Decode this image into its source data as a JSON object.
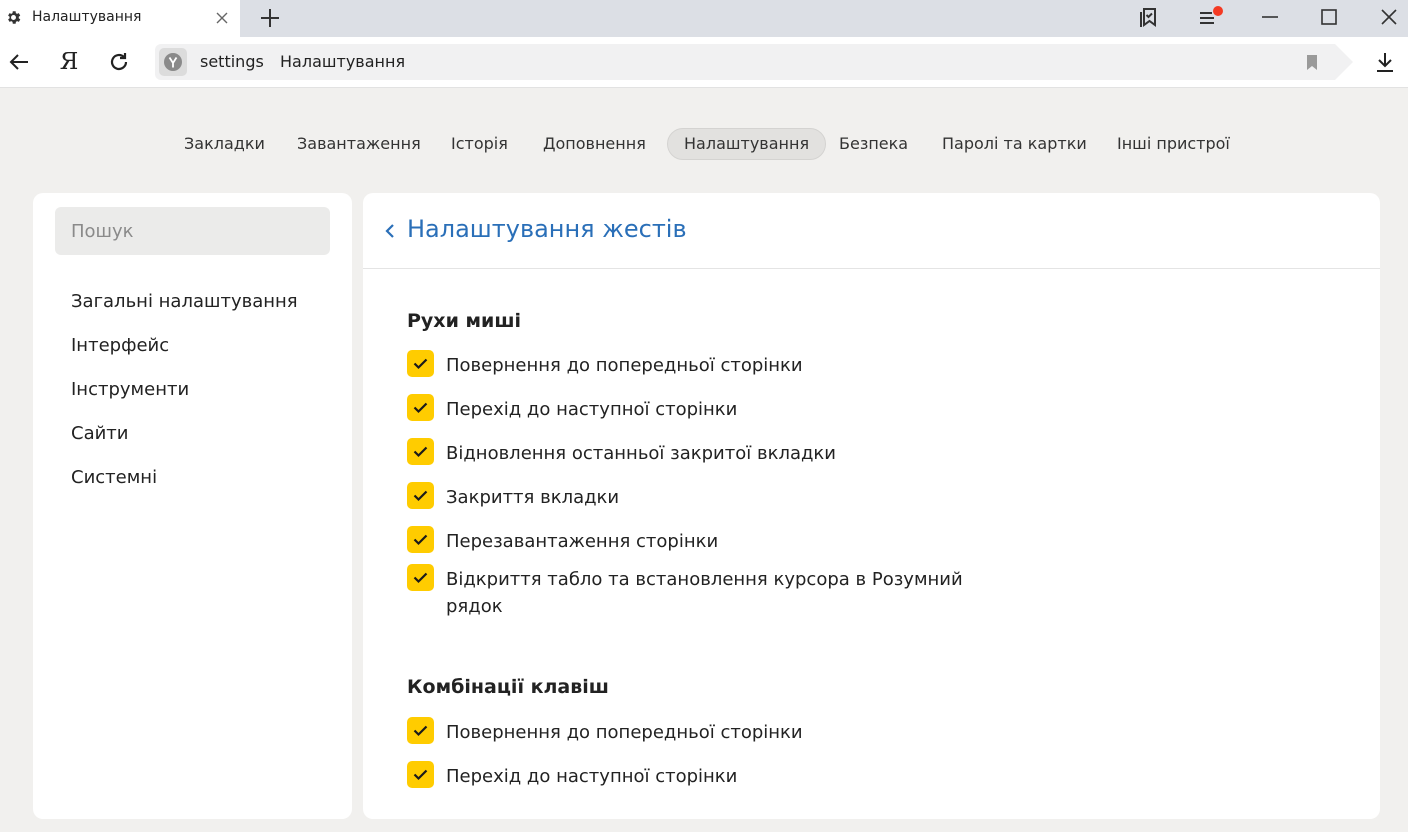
{
  "tab": {
    "title": "Налаштування"
  },
  "address": {
    "host": "settings",
    "title": "Налаштування"
  },
  "nav": [
    "Закладки",
    "Завантаження",
    "Історія",
    "Доповнення",
    "Налаштування",
    "Безпека",
    "Паролі та картки",
    "Інші пристрої"
  ],
  "nav_active": "Налаштування",
  "sidebar": {
    "search_placeholder": "Пошук",
    "items": [
      "Загальні налаштування",
      "Інтерфейс",
      "Інструменти",
      "Сайти",
      "Системні"
    ]
  },
  "panel": {
    "title": "Налаштування жестів",
    "sections": [
      {
        "title": "Рухи миші",
        "options": [
          {
            "label": "Повернення до попередньої сторінки",
            "checked": true
          },
          {
            "label": "Перехід до наступної сторінки",
            "checked": true
          },
          {
            "label": "Відновлення останньої закритої вкладки",
            "checked": true
          },
          {
            "label": "Закриття вкладки",
            "checked": true
          },
          {
            "label": "Перезавантаження сторінки",
            "checked": true
          },
          {
            "label": "Відкриття табло та встановлення курсора в Розумний рядок",
            "checked": true
          }
        ]
      },
      {
        "title": "Комбінації клавіш",
        "options": [
          {
            "label": "Повернення до попередньої сторінки",
            "checked": true
          },
          {
            "label": "Перехід до наступної сторінки",
            "checked": true
          }
        ]
      }
    ]
  },
  "colors": {
    "accent": "#ffcc00",
    "link": "#2a6fb8",
    "notification": "#f43a23"
  }
}
